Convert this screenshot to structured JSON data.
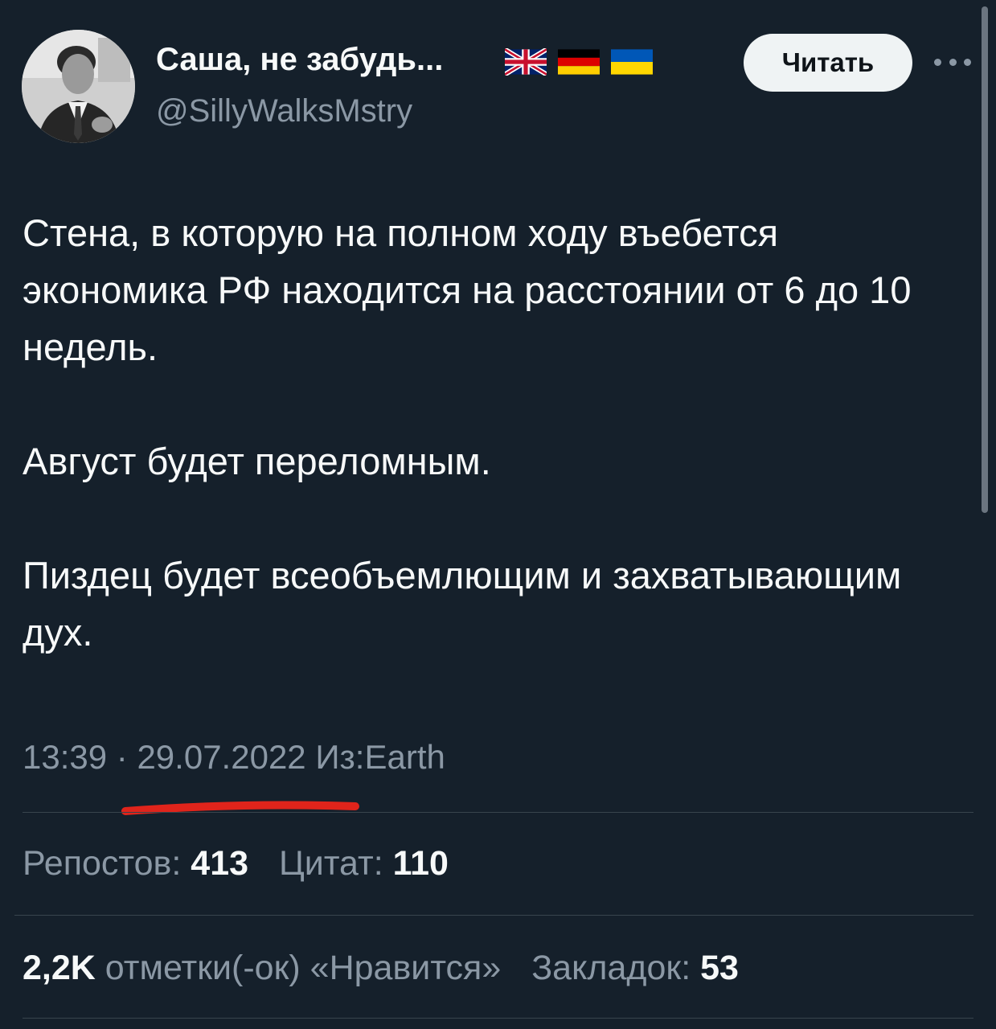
{
  "author": {
    "name": "Саша, не забудь...",
    "handle": "@SillyWalksMstry"
  },
  "header": {
    "read_button_label": "Читать"
  },
  "tweet": {
    "paragraphs": [
      "Стена, в которую на полном ходу въебется экономика РФ находится на расстоянии от 6 до 10 недель.",
      "Август будет переломным.",
      "Пиздец будет всеобъемлющим и захватывающим дух."
    ],
    "time": "13:39",
    "separator": "·",
    "date": "29.07.2022",
    "source": "Из:Earth"
  },
  "stats": {
    "reposts_label": "Репостов:",
    "reposts_value": "413",
    "quotes_label": "Цитат:",
    "quotes_value": "110",
    "likes_value": "2,2K",
    "likes_label": "отметки(-ок) «Нравится»",
    "bookmarks_label": "Закладок:",
    "bookmarks_value": "53"
  },
  "colors": {
    "background": "#15202b",
    "text": "#f7f9f9",
    "secondary_text": "#8b98a5",
    "highlight_underline": "#e0241b"
  },
  "icons": {
    "more": "more-horizontal-icon",
    "flags": [
      "uk-flag-icon",
      "germany-flag-icon",
      "ukraine-flag-icon"
    ]
  }
}
